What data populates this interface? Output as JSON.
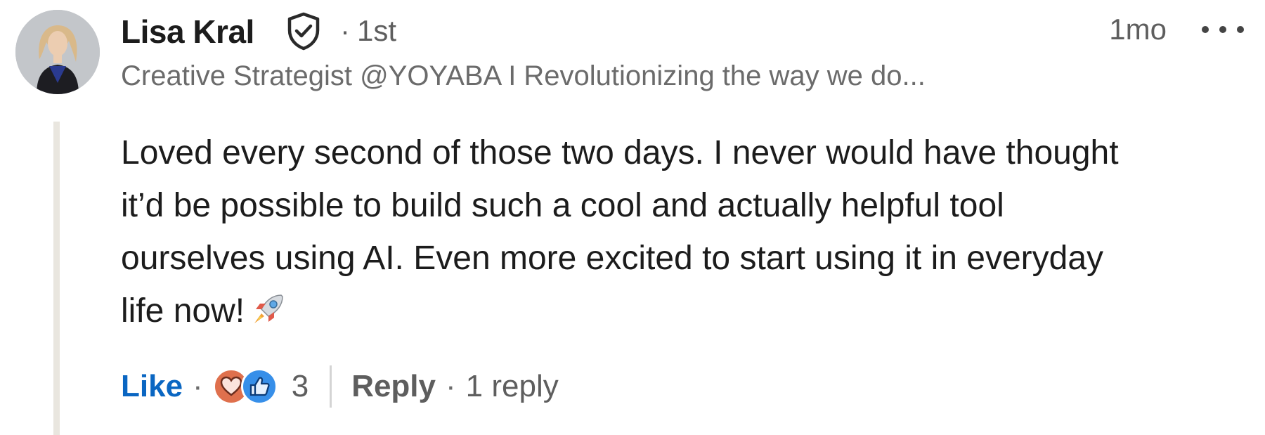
{
  "comment": {
    "author_name": "Lisa Kral",
    "verified_icon": "shield-check-icon",
    "connection_degree": "1st",
    "degree_separator": "·",
    "timestamp": "1mo",
    "more_icon": "more-horizontal-icon",
    "headline": "Creative Strategist @YOYABA I Revolutionizing the way we do...",
    "body_lines": [
      "Loved every second of those two days. I never would have thought",
      "it’d be possible to build such a cool and actually helpful tool",
      "ourselves using AI. Even more excited to start using it in everyday",
      "life now!"
    ],
    "body_emoji": "rocket-icon"
  },
  "actions": {
    "like_label": "Like",
    "separator": "·",
    "reactions": [
      "love-reaction-icon",
      "like-reaction-icon"
    ],
    "reaction_count": "3",
    "reply_label": "Reply",
    "reply_count": "1 reply"
  },
  "colors": {
    "like_blue": "#0a66c2",
    "love_orange": "#df704d",
    "like_reaction_blue": "#378fe9",
    "muted_text": "#5e5e5e",
    "thread_line": "#e9e6df"
  }
}
